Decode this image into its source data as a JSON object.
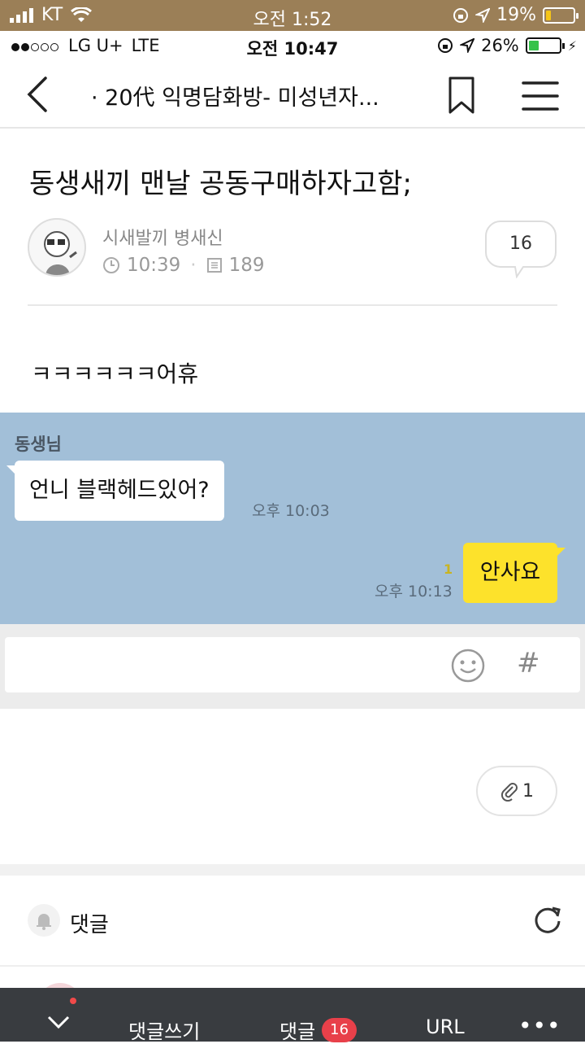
{
  "outer_status": {
    "carrier": "KT",
    "time": "오전 1:52",
    "battery": "19%"
  },
  "inner_status": {
    "carrier": "LG U+",
    "network": "LTE",
    "time": "오전 10:47",
    "battery": "26%"
  },
  "navbar": {
    "title": "· 20代 익명담화방- 미성년자..."
  },
  "post": {
    "title": "동생새끼 맨날 공동구매하자고함;",
    "author": "시새발끼 병새신",
    "time": "10:39",
    "views": "189",
    "comment_count": "16",
    "body": "ㅋㅋㅋㅋㅋㅋ어휴"
  },
  "chat": {
    "sender": "동생님",
    "received": {
      "text": "언니 블랙헤드있어?",
      "time": "오후 10:03"
    },
    "sent": {
      "text": "안사요",
      "time": "오후 10:13",
      "unread": "1"
    }
  },
  "attachment": {
    "count": "1"
  },
  "comments_section": {
    "label": "댓글"
  },
  "bottom_bar": {
    "write": "댓글쓰기",
    "comments": "댓글",
    "comments_badge": "16",
    "url": "URL",
    "more": "•••"
  },
  "colors": {
    "chat_bg": "#a2bfd8",
    "sent_bubble": "#fde22b",
    "badge": "#e8404a",
    "bottom_bar": "#393c40",
    "outer_status": "#9b7f57"
  }
}
